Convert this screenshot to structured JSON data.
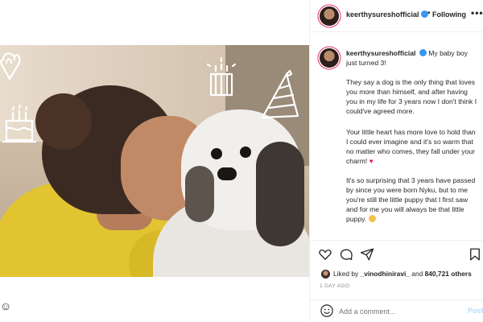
{
  "header": {
    "username": "keerthysureshofficial",
    "separator": "•",
    "follow_status": "Following",
    "more_label": "•••"
  },
  "caption": {
    "username": "keerthysureshofficial",
    "first_line": "My baby boy just turned 3!",
    "paragraphs": [
      "They say a dog is the only thing that loves you more than himself, and after having you in my life for 3 years now I don't think I could've agreed more.",
      "Your little heart has more love to hold than I could ever imagine and it's so warm that no matter who comes, they fall under your charm!",
      "It's so surprising that 3 years have passed by since you were born Nyku, but to me you're still the little puppy that I first saw and for me you will always be that little puppy."
    ],
    "heart_emoji": "♥"
  },
  "likes": {
    "prefix": "Liked by",
    "liker": "_vinodhiniravi_",
    "connector": "and",
    "count_text": "840,721 others"
  },
  "time_ago": "1 DAY AGO",
  "comment": {
    "placeholder": "Add a comment...",
    "post_label": "Post"
  },
  "edge_glyph": "☺",
  "colors": {
    "verified": "#3897f0",
    "heart": "#e0245e",
    "post_disabled": "#b2dffc",
    "shirt_yellow": "#e2c431"
  },
  "icons": [
    "heart-icon",
    "comment-icon",
    "share-icon",
    "bookmark-icon",
    "emoji-icon",
    "verified-icon"
  ]
}
